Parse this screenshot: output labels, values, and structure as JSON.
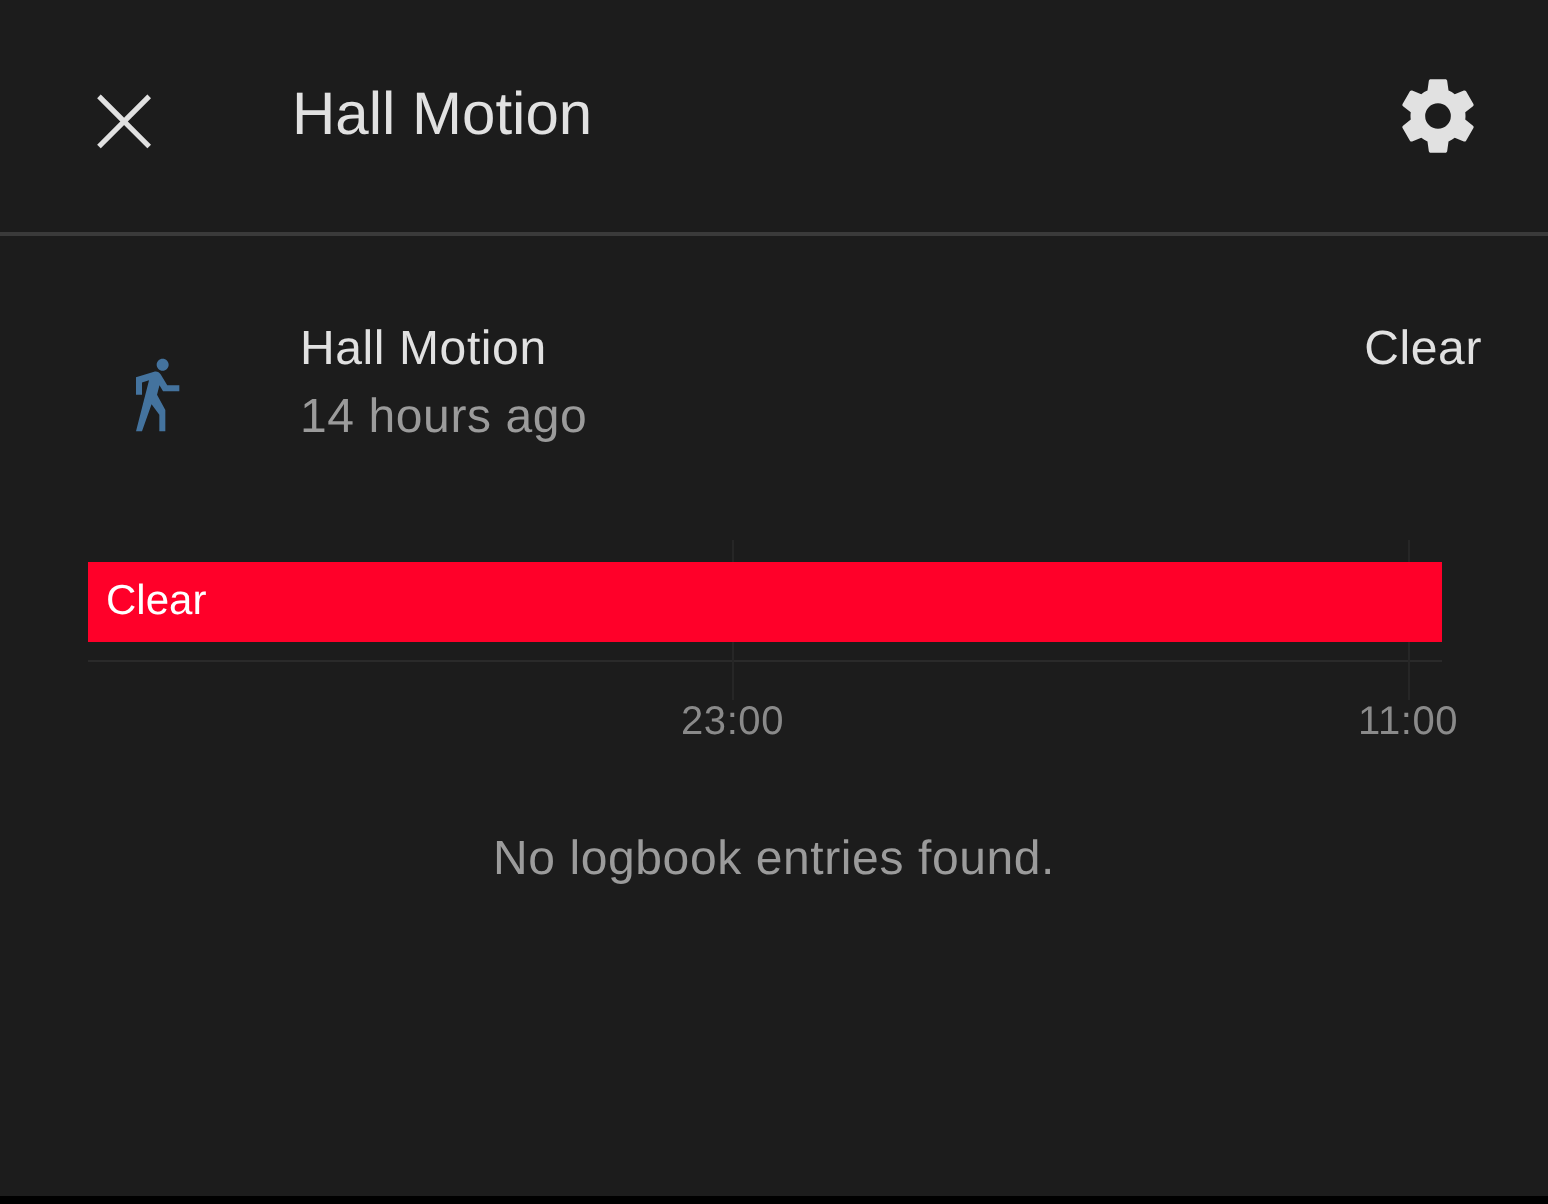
{
  "header": {
    "close": "×",
    "title": "Hall Motion"
  },
  "entity": {
    "name": "Hall Motion",
    "time": "14 hours ago",
    "state": "Clear"
  },
  "timeline": {
    "segments": [
      {
        "label": "Clear",
        "color": "#ff0029",
        "level": 1
      }
    ],
    "ticks": [
      "23:00",
      "11:00"
    ]
  },
  "logbook": {
    "message": "No logbook entries found."
  }
}
